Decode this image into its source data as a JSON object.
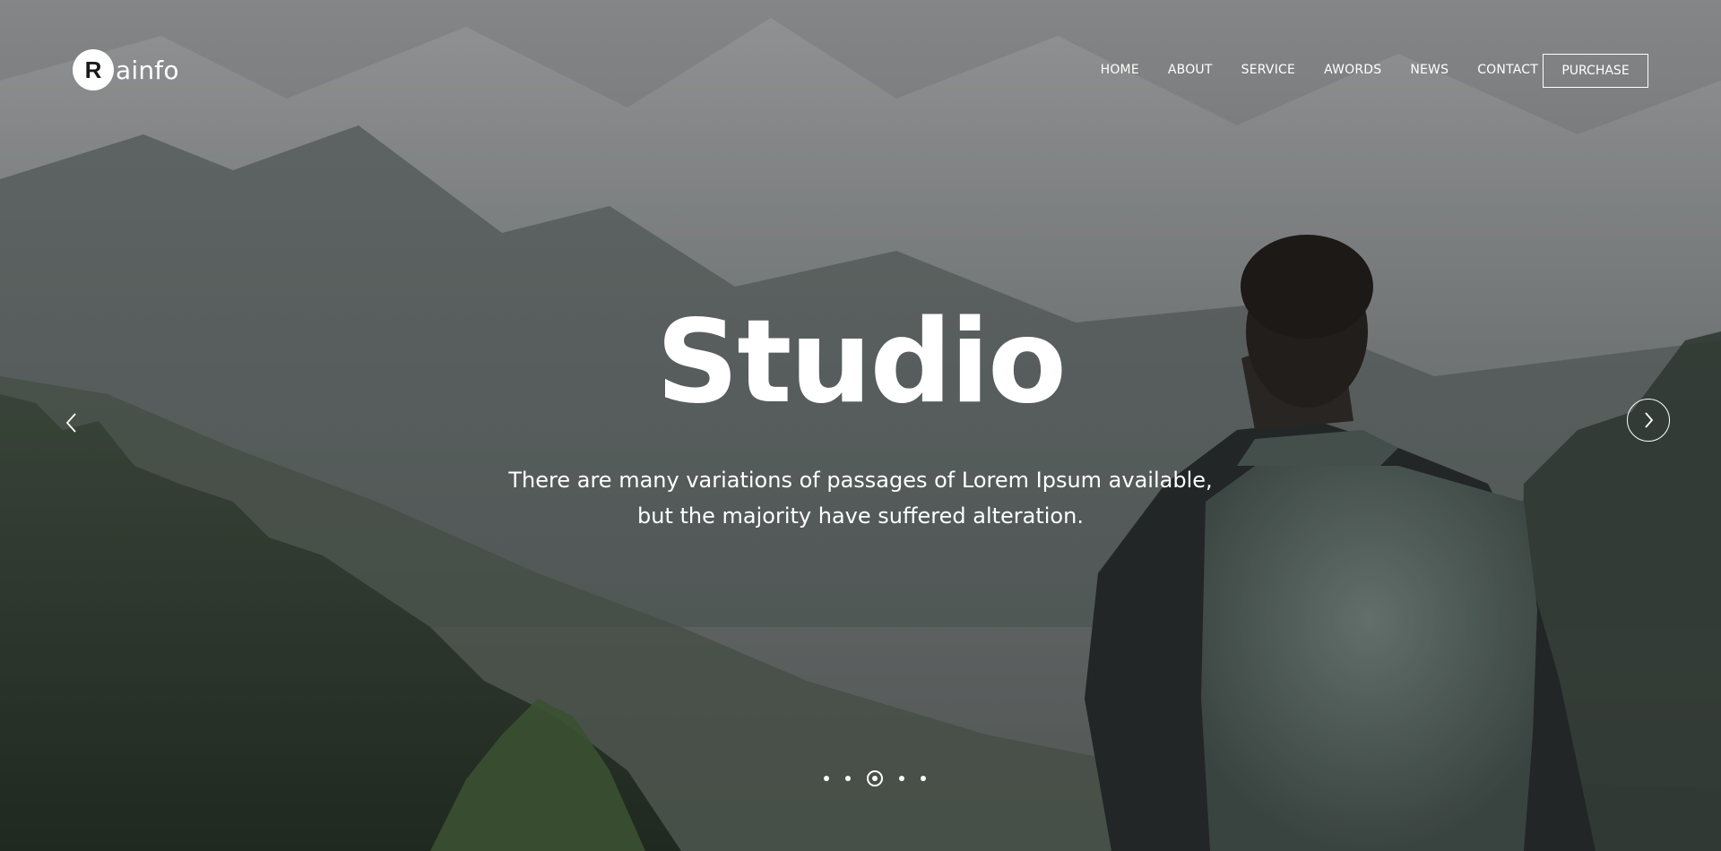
{
  "brand": {
    "logo_letter": "R",
    "logo_text": "ainfo"
  },
  "nav": {
    "items": [
      "HOME",
      "ABOUT",
      "SERVICE",
      "AWORDS",
      "NEWS",
      "CONTACT"
    ],
    "purchase_label": "PURCHASE"
  },
  "hero": {
    "title": "Studio",
    "subtitle_line1": "There are many variations of passages of Lorem Ipsum available,",
    "subtitle_line2": "but the majority have suffered alteration."
  },
  "slider": {
    "slide_count": 5,
    "active_index": 2
  },
  "colors": {
    "text": "#ffffff",
    "accent": "#ffffff"
  },
  "icons": {
    "prev": "chevron-left-icon",
    "next": "chevron-right-icon"
  }
}
